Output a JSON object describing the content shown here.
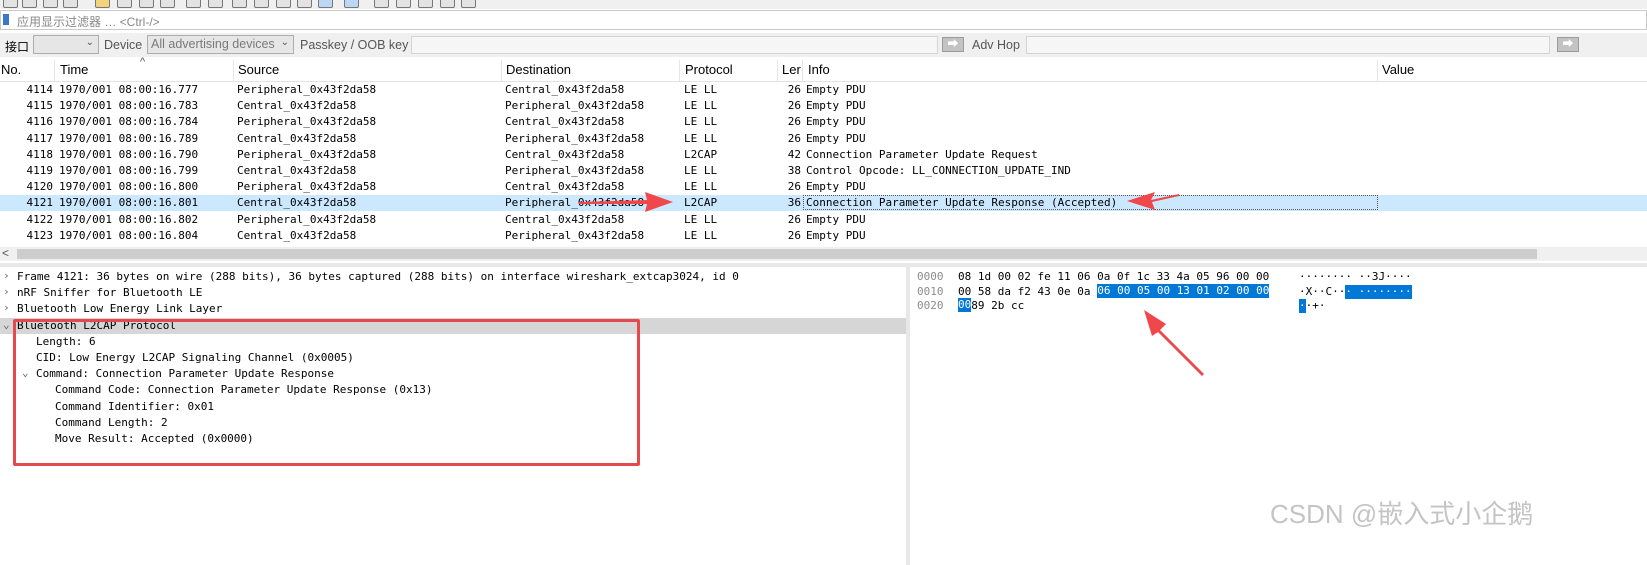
{
  "filter": {
    "placeholder": "应用显示过滤器 … <Ctrl-/>"
  },
  "extcap": {
    "interface_label": "接口",
    "interface_value": "",
    "device_label": "Device",
    "device_value": "All advertising devices",
    "passkey_label": "Passkey / OOB key",
    "adv_hop_label": "Adv Hop"
  },
  "packet_list": {
    "columns": [
      "No.",
      "Time",
      "Source",
      "Destination",
      "Protocol",
      "Ler",
      "Info",
      "Value"
    ],
    "rows": [
      {
        "no": "4114",
        "time": "1970/001 08:00:16.777",
        "src": "Peripheral_0x43f2da58",
        "dst": "Central_0x43f2da58",
        "proto": "LE LL",
        "len": "26",
        "info": "Empty PDU"
      },
      {
        "no": "4115",
        "time": "1970/001 08:00:16.783",
        "src": "Central_0x43f2da58",
        "dst": "Peripheral_0x43f2da58",
        "proto": "LE LL",
        "len": "26",
        "info": "Empty PDU"
      },
      {
        "no": "4116",
        "time": "1970/001 08:00:16.784",
        "src": "Peripheral_0x43f2da58",
        "dst": "Central_0x43f2da58",
        "proto": "LE LL",
        "len": "26",
        "info": "Empty PDU"
      },
      {
        "no": "4117",
        "time": "1970/001 08:00:16.789",
        "src": "Central_0x43f2da58",
        "dst": "Peripheral_0x43f2da58",
        "proto": "LE LL",
        "len": "26",
        "info": "Empty PDU"
      },
      {
        "no": "4118",
        "time": "1970/001 08:00:16.790",
        "src": "Peripheral_0x43f2da58",
        "dst": "Central_0x43f2da58",
        "proto": "L2CAP",
        "len": "42",
        "info": "Connection Parameter Update Request"
      },
      {
        "no": "4119",
        "time": "1970/001 08:00:16.799",
        "src": "Central_0x43f2da58",
        "dst": "Peripheral_0x43f2da58",
        "proto": "LE LL",
        "len": "38",
        "info": "Control Opcode: LL_CONNECTION_UPDATE_IND"
      },
      {
        "no": "4120",
        "time": "1970/001 08:00:16.800",
        "src": "Peripheral_0x43f2da58",
        "dst": "Central_0x43f2da58",
        "proto": "LE LL",
        "len": "26",
        "info": "Empty PDU"
      },
      {
        "no": "4121",
        "time": "1970/001 08:00:16.801",
        "src": "Central_0x43f2da58",
        "dst": "Peripheral_0x43f2da58",
        "proto": "L2CAP",
        "len": "36",
        "info": "Connection Parameter Update Response (Accepted)"
      },
      {
        "no": "4122",
        "time": "1970/001 08:00:16.802",
        "src": "Peripheral_0x43f2da58",
        "dst": "Central_0x43f2da58",
        "proto": "LE LL",
        "len": "26",
        "info": "Empty PDU"
      },
      {
        "no": "4123",
        "time": "1970/001 08:00:16.804",
        "src": "Central_0x43f2da58",
        "dst": "Peripheral_0x43f2da58",
        "proto": "LE LL",
        "len": "26",
        "info": "Empty PDU"
      }
    ],
    "selected_no": "4121"
  },
  "details": [
    {
      "text": "Frame 4121: 36 bytes on wire (288 bits), 36 bytes captured (288 bits) on interface wireshark_extcap3024, id 0",
      "expander": "›"
    },
    {
      "text": "nRF Sniffer for Bluetooth LE",
      "expander": "›"
    },
    {
      "text": "Bluetooth Low Energy Link Layer",
      "expander": "›"
    },
    {
      "text": "Bluetooth L2CAP Protocol",
      "expander": "⌄"
    },
    {
      "text": "Length: 6",
      "expander": ""
    },
    {
      "text": "CID: Low Energy L2CAP Signaling Channel (0x0005)",
      "expander": ""
    },
    {
      "text": "Command: Connection Parameter Update Response",
      "expander": "⌄"
    },
    {
      "text": "Command Code: Connection Parameter Update Response (0x13)",
      "expander": ""
    },
    {
      "text": "Command Identifier: 0x01",
      "expander": ""
    },
    {
      "text": "Command Length: 2",
      "expander": ""
    },
    {
      "text": "Move Result: Accepted (0x0000)",
      "expander": ""
    }
  ],
  "bytes": [
    {
      "offset": "0000",
      "hex_a": "08 1d 00 02 fe 11 06 0a  0f 1c 33 4a 05 96 00 00",
      "hex_sel": "",
      "ascii_a": "········ ··3J····",
      "ascii_sel": ""
    },
    {
      "offset": "0010",
      "hex_a": "00 58 da f2 43 0e 0a ",
      "hex_sel": "06  00 05 00 13 01 02 00 00",
      "ascii_a": "·X··C··",
      "ascii_sel": "· ········"
    },
    {
      "offset": "0020",
      "hex_a": "",
      "hex_sel": "00",
      "hex_b": " 89 2b cc",
      "ascii_a": "",
      "ascii_sel": "·",
      "ascii_b": "·+·"
    }
  ],
  "watermark": "CSDN @嵌入式小企鹅",
  "colors": {
    "selection": "#cce8ff",
    "byte_highlight": "#0078d7",
    "annotation": "#e6494d"
  }
}
